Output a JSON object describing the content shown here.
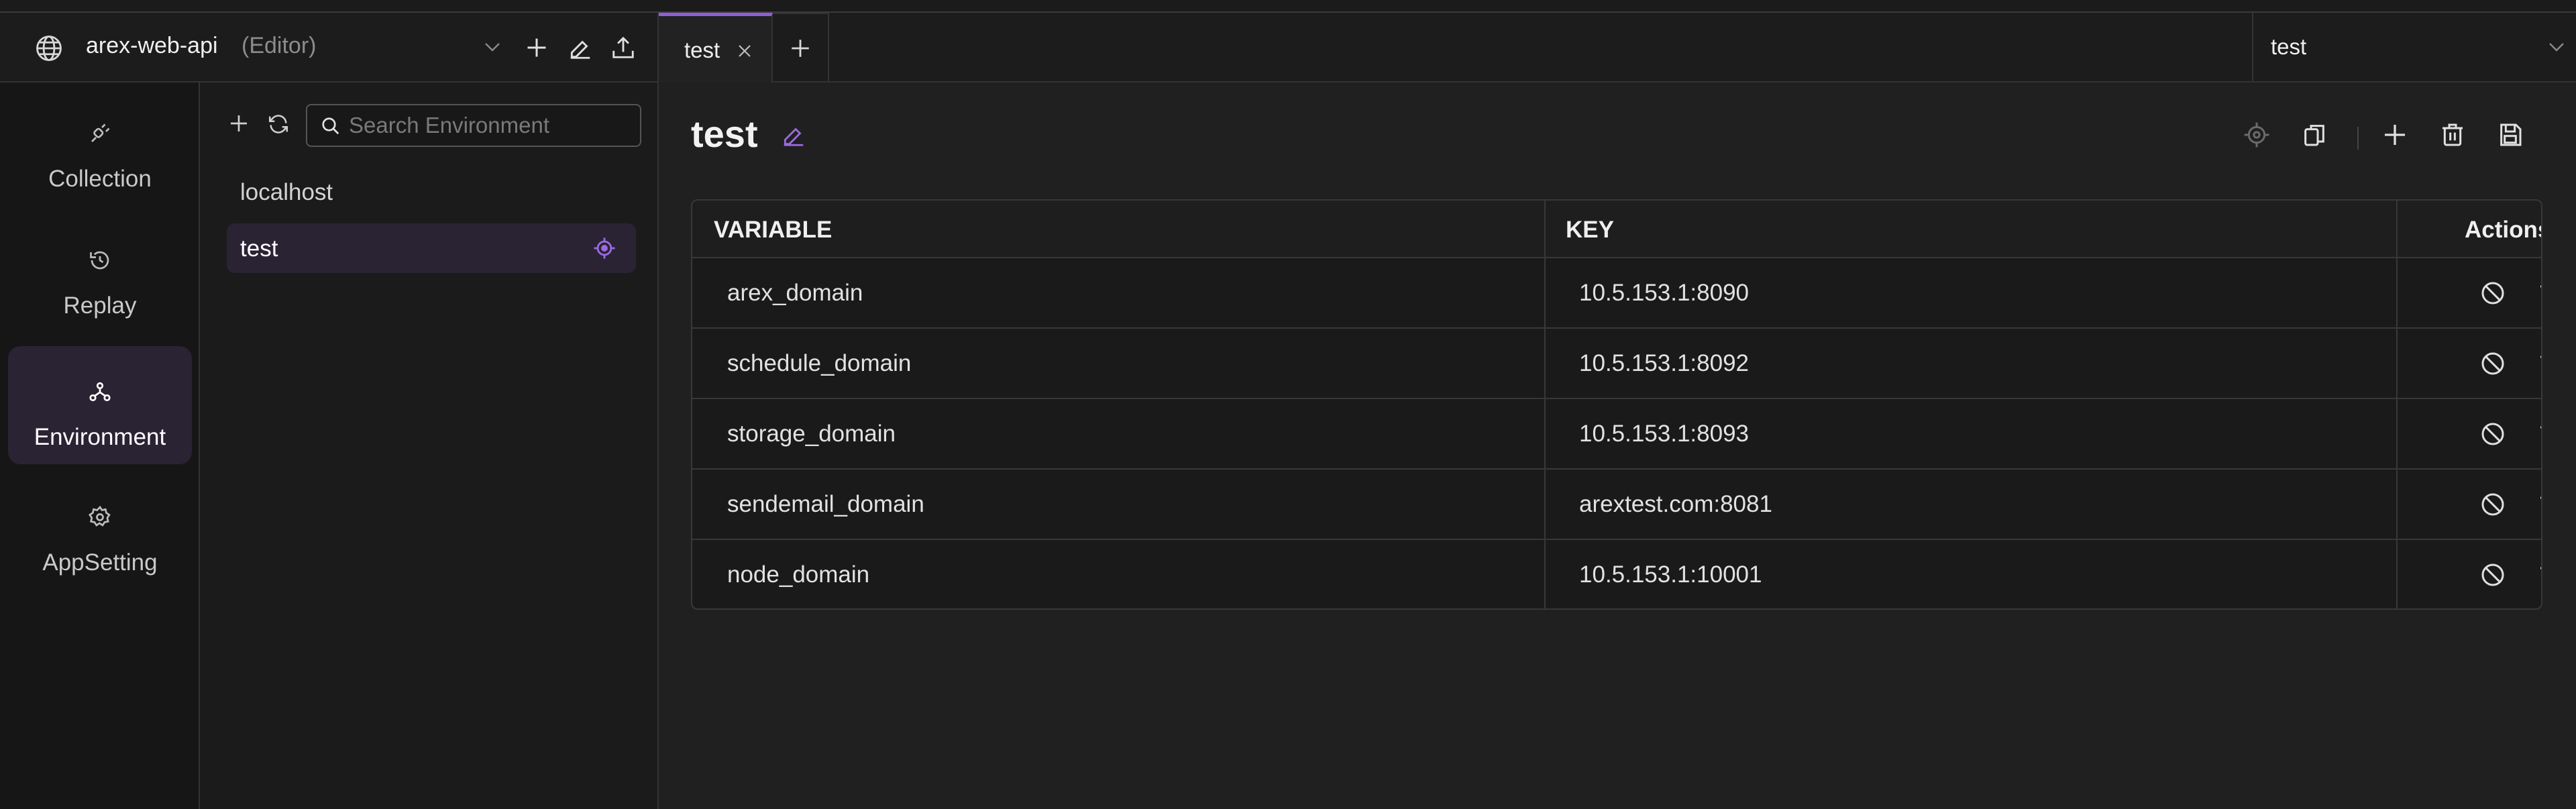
{
  "workspace": {
    "name": "arex-web-api",
    "mode": "(Editor)"
  },
  "tabs": [
    {
      "label": "test"
    }
  ],
  "environment_selector": {
    "value": "test"
  },
  "nav": {
    "items": [
      {
        "label": "Collection",
        "icon": "collection-icon"
      },
      {
        "label": "Replay",
        "icon": "replay-icon"
      },
      {
        "label": "Environment",
        "icon": "environment-icon",
        "active": true
      },
      {
        "label": "AppSetting",
        "icon": "settings-icon"
      }
    ]
  },
  "env_sidebar": {
    "search_placeholder": "Search Environment",
    "items": [
      {
        "label": "localhost"
      },
      {
        "label": "test",
        "active": true
      }
    ]
  },
  "main": {
    "title": "test",
    "table": {
      "headers": {
        "variable": "VARIABLE",
        "key": "KEY",
        "actions": "Actions"
      },
      "rows": [
        {
          "variable": "arex_domain",
          "key": "10.5.153.1:8090"
        },
        {
          "variable": "schedule_domain",
          "key": "10.5.153.1:8092"
        },
        {
          "variable": "storage_domain",
          "key": "10.5.153.1:8093"
        },
        {
          "variable": "sendemail_domain",
          "key": "arextest.com:8081"
        },
        {
          "variable": "node_domain",
          "key": "10.5.153.1:10001"
        }
      ]
    }
  },
  "colors": {
    "accent": "#8e5fd6",
    "background": "#202020"
  }
}
